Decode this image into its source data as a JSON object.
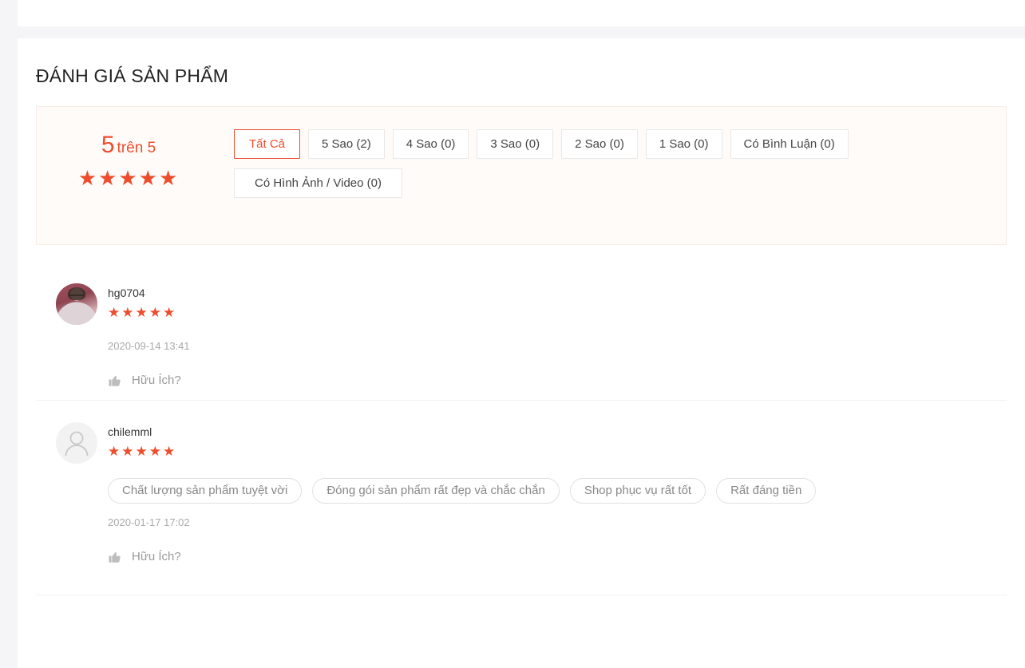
{
  "section": {
    "title": "ĐÁNH GIÁ SẢN PHẨM"
  },
  "summary": {
    "score_value": "5",
    "score_suffix": "trên 5",
    "stars_filled": 5,
    "star_glyph": "★",
    "accent_color": "#ee4d2d"
  },
  "filters": {
    "row1": [
      {
        "label": "Tất Cả",
        "active": true
      },
      {
        "label": "5 Sao (2)",
        "active": false
      },
      {
        "label": "4 Sao (0)",
        "active": false
      },
      {
        "label": "3 Sao (0)",
        "active": false
      },
      {
        "label": "2 Sao (0)",
        "active": false
      },
      {
        "label": "1 Sao (0)",
        "active": false
      },
      {
        "label": "Có Bình Luận (0)",
        "active": false
      }
    ],
    "row2": [
      {
        "label": "Có Hình Ảnh / Video (0)",
        "active": false
      }
    ]
  },
  "reviews": [
    {
      "username": "hg0704",
      "stars": 5,
      "avatar_type": "photo",
      "tags": [],
      "date": "2020-09-14 13:41",
      "helpful_label": "Hữu Ích?"
    },
    {
      "username": "chilemml",
      "stars": 5,
      "avatar_type": "default",
      "tags": [
        "Chất lượng sản phẩm tuyệt vời",
        "Đóng gói sản phẩm rất đẹp và chắc chắn",
        "Shop phục vụ rất tốt",
        "Rất đáng tiền"
      ],
      "date": "2020-01-17 17:02",
      "helpful_label": "Hữu Ích?"
    }
  ]
}
